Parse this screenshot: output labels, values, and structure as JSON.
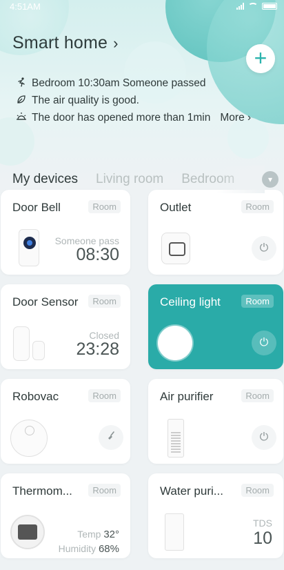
{
  "status_bar": {
    "time": "4:51AM"
  },
  "header": {
    "title": "Smart home",
    "title_chevron": "›",
    "add_symbol": "+"
  },
  "events": [
    {
      "icon": "running-person-icon",
      "text": "Bedroom 10:30am Someone passed"
    },
    {
      "icon": "leaf-icon",
      "text": "The air quality is good."
    },
    {
      "icon": "sun-icon",
      "text": "The door has opened more than 1min"
    }
  ],
  "events_more": "More ›",
  "tabs": [
    {
      "label": "My devices",
      "active": true
    },
    {
      "label": "Living room",
      "active": false
    },
    {
      "label": "Bedroom",
      "active": false
    }
  ],
  "devices": {
    "door_bell": {
      "name": "Door Bell",
      "room": "Room",
      "status_label": "Someone pass",
      "status_value": "08:30"
    },
    "outlet": {
      "name": "Outlet",
      "room": "Room"
    },
    "door_sensor": {
      "name": "Door Sensor",
      "room": "Room",
      "status_label": "Closed",
      "status_value": "23:28"
    },
    "ceiling_light": {
      "name": "Ceiling light",
      "room": "Room",
      "active": true
    },
    "robovac": {
      "name": "Robovac",
      "room": "Room"
    },
    "air_purifier": {
      "name": "Air purifier",
      "room": "Room"
    },
    "thermometer": {
      "name": "Thermom...",
      "room": "Room",
      "temp_label": "Temp",
      "temp_value": "32°",
      "humidity_label": "Humidity",
      "humidity_value": "68%"
    },
    "water_purifier": {
      "name": "Water puri...",
      "room": "Room",
      "tds_label": "TDS",
      "tds_value": "10"
    }
  },
  "colors": {
    "accent": "#2aaba8",
    "active_card": "#2aaba8",
    "text_dark": "#2f3a3a",
    "muted": "#b0b7b8"
  }
}
